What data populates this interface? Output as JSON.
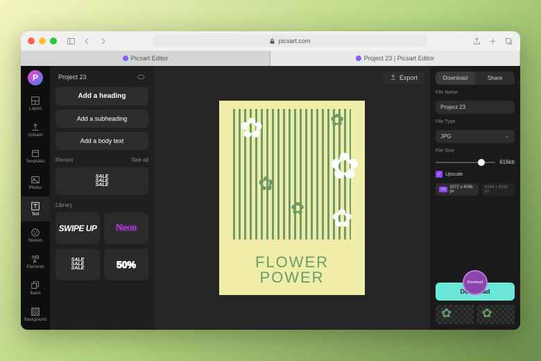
{
  "browser": {
    "url": "picsart.com",
    "tabs": [
      {
        "label": "Picsart Editor"
      },
      {
        "label": "Project 23 | Picsart Editor"
      }
    ]
  },
  "project": {
    "name": "Project 23"
  },
  "nav": [
    {
      "id": "layout",
      "label": "Layout"
    },
    {
      "id": "uploads",
      "label": "Uploads"
    },
    {
      "id": "templates",
      "label": "Templates"
    },
    {
      "id": "photos",
      "label": "Photos"
    },
    {
      "id": "text",
      "label": "Text",
      "active": true
    },
    {
      "id": "stickers",
      "label": "Stickers"
    },
    {
      "id": "elements",
      "label": "Elements"
    },
    {
      "id": "batch",
      "label": "Batch"
    },
    {
      "id": "background",
      "label": "Background"
    }
  ],
  "textPanel": {
    "heading": "Add a heading",
    "sub": "Add a subheading",
    "body": "Add a body text",
    "recent": "Recent",
    "see_all": "See all",
    "library": "Library",
    "thumbs": {
      "sale": "SALE\nSALE\nSALE",
      "swipe": "SWIPE UP",
      "neon": "Neon",
      "fifty": "50%"
    }
  },
  "canvas": {
    "line1": "FLOWER",
    "line2": "POWER"
  },
  "export": {
    "btn": "Export",
    "download": "Download",
    "share": "Share",
    "filename_label": "File Name",
    "filename": "Project 23",
    "filetype_label": "File Type",
    "filetype": "JPG",
    "filesize_label": "File Size",
    "filesize": "616kb",
    "upscale": "Upscale",
    "dim1": "3072 x 4096 px",
    "dim2": "6144 x 8192 px",
    "dim_badge": "x2",
    "download_btn": "Download"
  }
}
